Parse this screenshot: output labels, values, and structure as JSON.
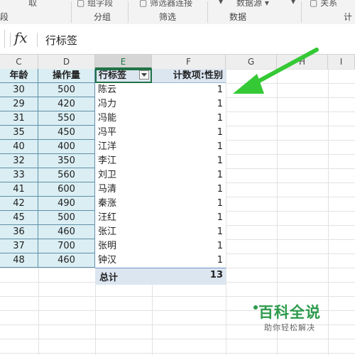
{
  "ribbon": {
    "buttons": [
      "取",
      "组字段",
      "筛选器连接",
      "数据源",
      "关系"
    ],
    "groups": [
      "段",
      "分组",
      "筛选",
      "数据",
      "计"
    ]
  },
  "formula_bar": {
    "fx_label": "fx",
    "value": "行标签"
  },
  "columns": [
    "C",
    "D",
    "E",
    "F",
    "G",
    "H",
    "I"
  ],
  "table": {
    "age_header": "年龄",
    "ops_header": "操作量",
    "ages": [
      "30",
      "29",
      "31",
      "35",
      "40",
      "32",
      "33",
      "41",
      "42",
      "45",
      "36",
      "37",
      "48"
    ],
    "ops": [
      "500",
      "420",
      "550",
      "450",
      "400",
      "350",
      "560",
      "600",
      "490",
      "500",
      "460",
      "700",
      "460"
    ]
  },
  "pivot": {
    "row_label_header": "行标签",
    "value_header": "计数项:性别",
    "names": [
      "陈云",
      "冯力",
      "冯能",
      "冯平",
      "江洋",
      "李江",
      "刘卫",
      "马清",
      "秦涨",
      "汪红",
      "张江",
      "张明",
      "钟汉"
    ],
    "counts": [
      "1",
      "1",
      "1",
      "1",
      "1",
      "1",
      "1",
      "1",
      "1",
      "1",
      "1",
      "1",
      "1"
    ],
    "total_label": "总计",
    "total_value": "13"
  },
  "watermark": {
    "title": "百科全说",
    "subtitle": "助你轻松解决"
  },
  "accent_color": "#217346",
  "arrow_color": "#3ad13a",
  "icons": [
    "dropdown-arrow-icon",
    "green-arrow-icon"
  ]
}
